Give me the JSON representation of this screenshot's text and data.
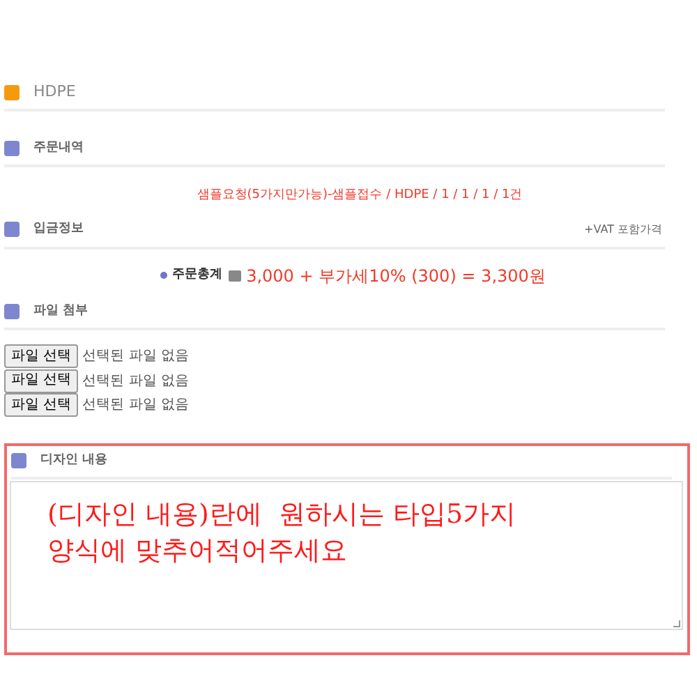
{
  "product": {
    "title": "HDPE"
  },
  "order": {
    "title": "주문내역",
    "summary": "샘플요청(5가지만가능)-샘플접수 / HDPE / 1 / 1 / 1 / 1건"
  },
  "payment": {
    "title": "입금정보",
    "note": "+VAT 포함가격",
    "total_label": "주문총계",
    "total": "3,000 + 부가세10% (300) = 3,300원"
  },
  "attachments": {
    "title": "파일 첨부",
    "files": [
      {
        "button": "파일 선택",
        "status": "선택된 파일 없음"
      },
      {
        "button": "파일 선택",
        "status": "선택된 파일 없음"
      },
      {
        "button": "파일 선택",
        "status": "선택된 파일 없음"
      }
    ]
  },
  "design": {
    "title": "디자인 내용",
    "annotation": [
      "(디자인 내용)란에  원하시는 타입5가지",
      "양식에 맞추어적어주세요"
    ]
  }
}
